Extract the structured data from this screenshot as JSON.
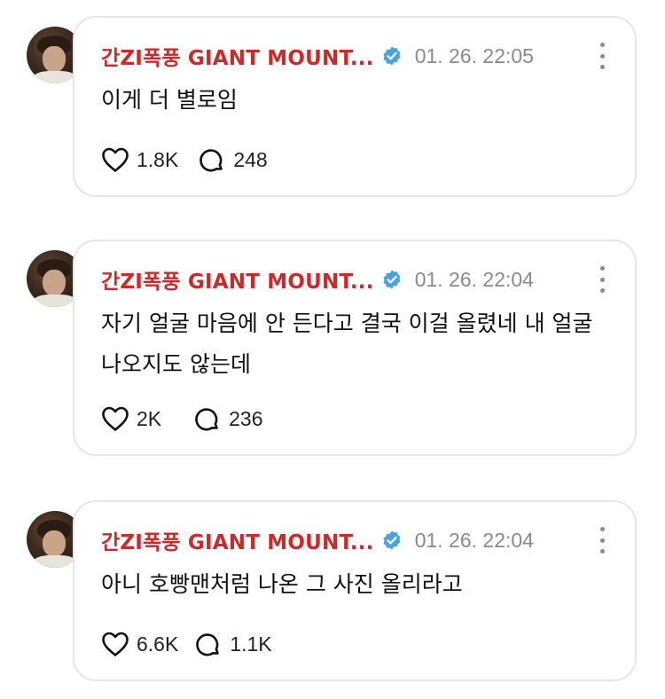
{
  "colors": {
    "author": "#c92a2a",
    "verified": "#4aa3df",
    "timestamp": "#8a8a8a",
    "border": "#e6e6e6"
  },
  "posts": [
    {
      "author": "간ZI폭풍 GIANT MOUNT...",
      "time": "01. 26. 22:05",
      "text": "이게 더 별로임",
      "likes": "1.8K",
      "comments": "248"
    },
    {
      "author": "간ZI폭풍 GIANT MOUNT...",
      "time": "01. 26. 22:04",
      "text": "자기 얼굴 마음에 안 든다고 결국 이걸 올렸네 내 얼굴 나오지도 않는데",
      "likes": "2K",
      "comments": "236"
    },
    {
      "author": "간ZI폭풍 GIANT MOUNT...",
      "time": "01. 26. 22:04",
      "text": "아니 호빵맨처럼 나온 그 사진 올리라고",
      "likes": "6.6K",
      "comments": "1.1K"
    }
  ],
  "icons": {
    "verified": "verified-badge-icon",
    "more": "more-vertical-icon",
    "like": "heart-icon",
    "comment": "comment-bubble-icon"
  }
}
